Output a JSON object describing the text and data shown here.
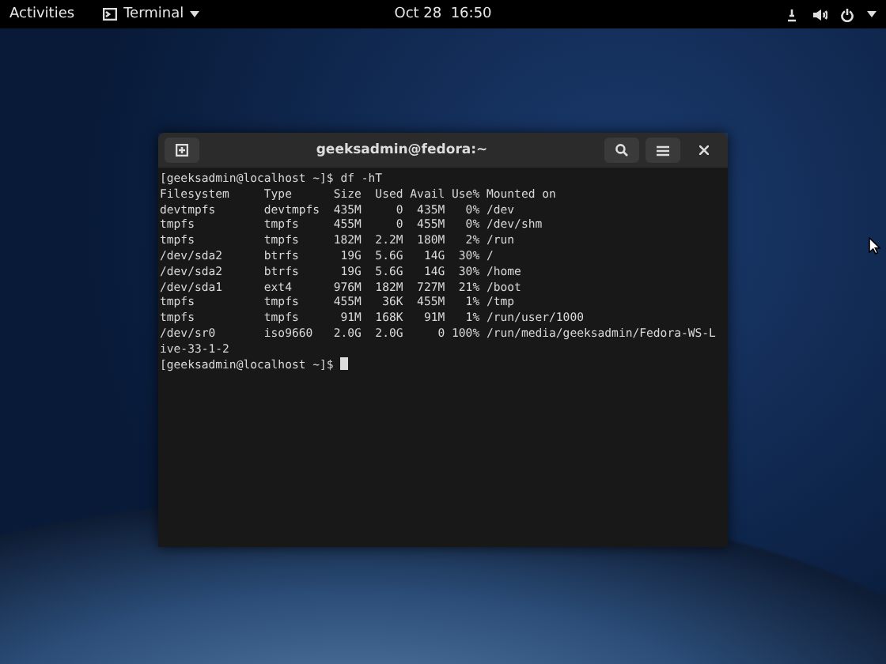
{
  "top_bar": {
    "activities": "Activities",
    "app_menu": "Terminal",
    "clock": "Oct 28  16:50"
  },
  "terminal": {
    "title": "geeksadmin@fedora:~",
    "lines": [
      "[geeksadmin@localhost ~]$ df -hT",
      "Filesystem     Type      Size  Used Avail Use% Mounted on",
      "devtmpfs       devtmpfs  435M     0  435M   0% /dev",
      "tmpfs          tmpfs     455M     0  455M   0% /dev/shm",
      "tmpfs          tmpfs     182M  2.2M  180M   2% /run",
      "/dev/sda2      btrfs      19G  5.6G   14G  30% /",
      "/dev/sda2      btrfs      19G  5.6G   14G  30% /home",
      "/dev/sda1      ext4      976M  182M  727M  21% /boot",
      "tmpfs          tmpfs     455M   36K  455M   1% /tmp",
      "tmpfs          tmpfs      91M  168K   91M   1% /run/user/1000",
      "/dev/sr0       iso9660   2.0G  2.0G     0 100% /run/media/geeksadmin/Fedora-WS-L",
      "ive-33-1-2",
      "[geeksadmin@localhost ~]$ "
    ]
  }
}
